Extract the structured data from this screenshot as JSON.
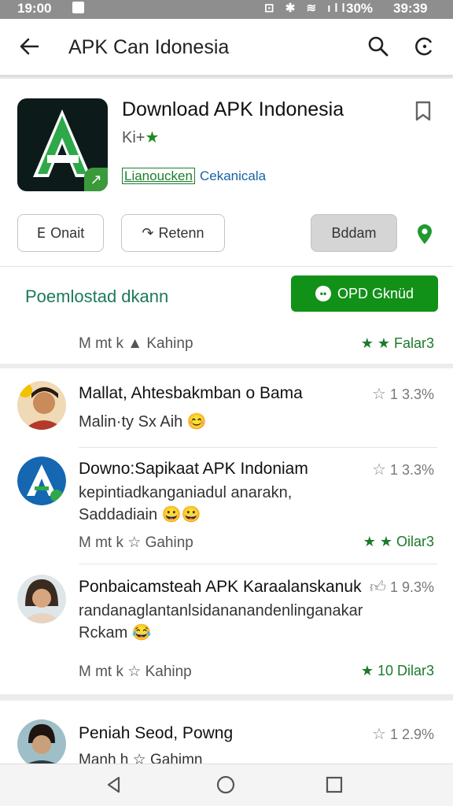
{
  "status_bar": {
    "time": "19:00",
    "icons": "⊡ ✱ ≋ ıll",
    "battery": "30%",
    "clock_right": "39:39"
  },
  "toolbar": {
    "title": "APK Can Idonesia"
  },
  "app": {
    "title": "Download APK Indonesia",
    "subtitle": "Ki+",
    "subtitle_star": "★",
    "tag_green": "Lianoucken",
    "tag_blue": "Cekanicala",
    "buttons": {
      "onait": "Onait",
      "retenn": "Retenn",
      "bddam": "Bddam"
    },
    "promo_text": "Poemlostad dkann",
    "install_label": "OPD Gknüd",
    "meta_left": "M mt k ▲ Kahinp",
    "meta_right": "★ ★ Falar3"
  },
  "reviews": [
    {
      "name": "Mallat, Ahtesbakmban o Bama",
      "body": "Malin·ty Sx Aih 😊",
      "rating": "1  3.3%"
    },
    {
      "name": "Downo:Sapikaat APK Indoniam",
      "body": "kepintiadkanganiadul anarakn, Saddadiain 😀😀",
      "rating": "1  3.3%",
      "meta_left": "M mt k ☆ Gahinp",
      "meta_right": "★ ★ Oilar3"
    },
    {
      "name": "Ponbaicamsteah APK Karaalanskanuk",
      "body": "randanaglantanlsidananandenlinganakar Rckam 😂",
      "rating": "1  9.3%",
      "meta_left": "M mt k ☆ Kahinp",
      "meta_right": "★ 10 Dilar3"
    },
    {
      "name": "Peniah Seod, Powng",
      "body": "Manh h ☆ Gahimn",
      "rating": "1  2.9%"
    }
  ],
  "colors": {
    "accent_green": "#119118",
    "link_blue": "#1663a6",
    "status_bar": "#8e8e8e"
  },
  "icons": [
    "back-arrow-icon",
    "search-icon",
    "more-icon",
    "bookmark-icon",
    "pin-icon",
    "star-icon",
    "thumb-icon",
    "nav-back-icon",
    "nav-home-icon",
    "nav-recents-icon"
  ]
}
